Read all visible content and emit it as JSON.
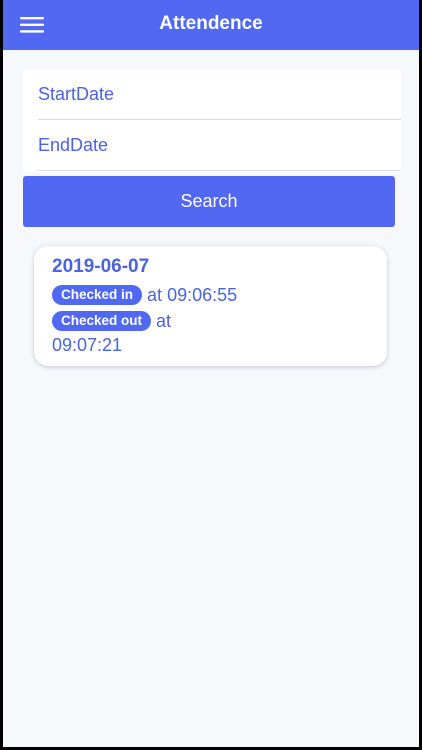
{
  "header": {
    "title": "Attendence",
    "menu_icon": "hamburger-menu-icon"
  },
  "search_form": {
    "start_date_placeholder": "StartDate",
    "end_date_placeholder": "EndDate",
    "search_label": "Search"
  },
  "records": [
    {
      "date": "2019-06-07",
      "checked_in_label": "Checked in",
      "checked_in_prefix": "at",
      "checked_in_time": "09:06:55",
      "checked_out_label": "Checked out",
      "checked_out_prefix": "at",
      "checked_out_time": "09:07:21"
    }
  ],
  "colors": {
    "accent": "#5068f2",
    "text_accent": "#4b63de",
    "background": "#f7f8fb",
    "card": "#ffffff",
    "frame": "#000000"
  }
}
